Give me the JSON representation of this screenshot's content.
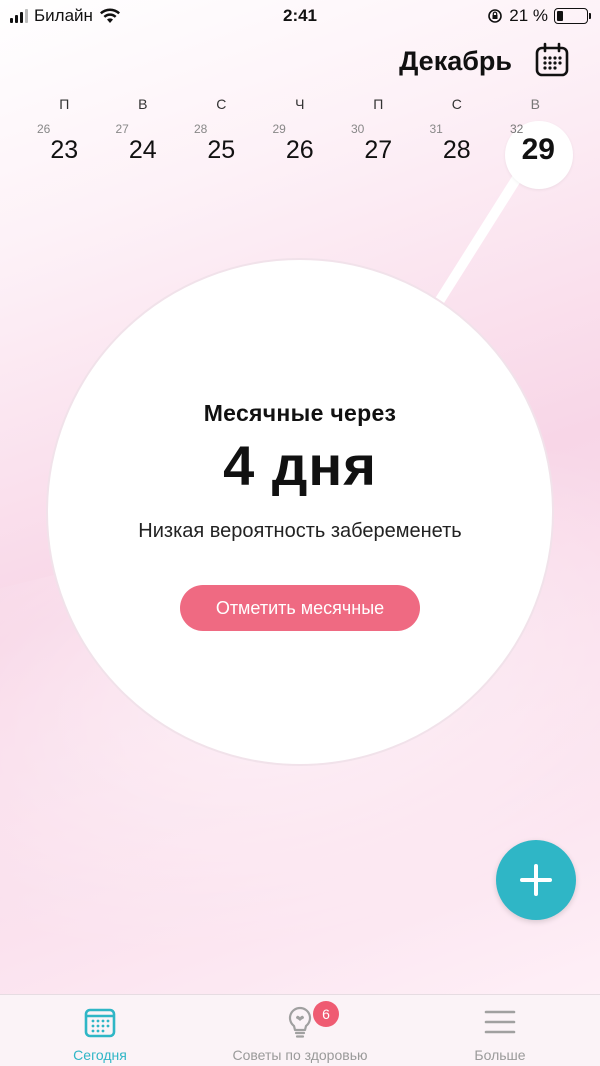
{
  "status_bar": {
    "carrier": "Билайн",
    "time": "2:41",
    "battery_percent_text": "21 %",
    "battery_level": 0.21
  },
  "header": {
    "month": "Декабрь",
    "calendar_icon": "calendar-icon"
  },
  "week": [
    {
      "weekday": "П",
      "cycle_day": "26",
      "date": "23"
    },
    {
      "weekday": "В",
      "cycle_day": "27",
      "date": "24"
    },
    {
      "weekday": "С",
      "cycle_day": "28",
      "date": "25"
    },
    {
      "weekday": "Ч",
      "cycle_day": "29",
      "date": "26"
    },
    {
      "weekday": "П",
      "cycle_day": "30",
      "date": "27"
    },
    {
      "weekday": "С",
      "cycle_day": "31",
      "date": "28"
    },
    {
      "weekday": "В",
      "cycle_day": "32",
      "date": "29",
      "selected": true
    }
  ],
  "main": {
    "title": "Месячные через",
    "countdown": "4 дня",
    "subtitle": "Низкая вероятность забеременеть",
    "button_label": "Отметить месячные"
  },
  "fab": {
    "icon": "plus-icon"
  },
  "tabs": [
    {
      "label": "Сегодня",
      "icon": "calendar-icon",
      "active": true
    },
    {
      "label": "Советы по здоровью",
      "icon": "lightbulb-icon",
      "badge": "6"
    },
    {
      "label": "Больше",
      "icon": "menu-icon"
    }
  ],
  "colors": {
    "accent": "#2fb6c6",
    "button": "#ef6a82",
    "badge": "#ef5b72"
  }
}
